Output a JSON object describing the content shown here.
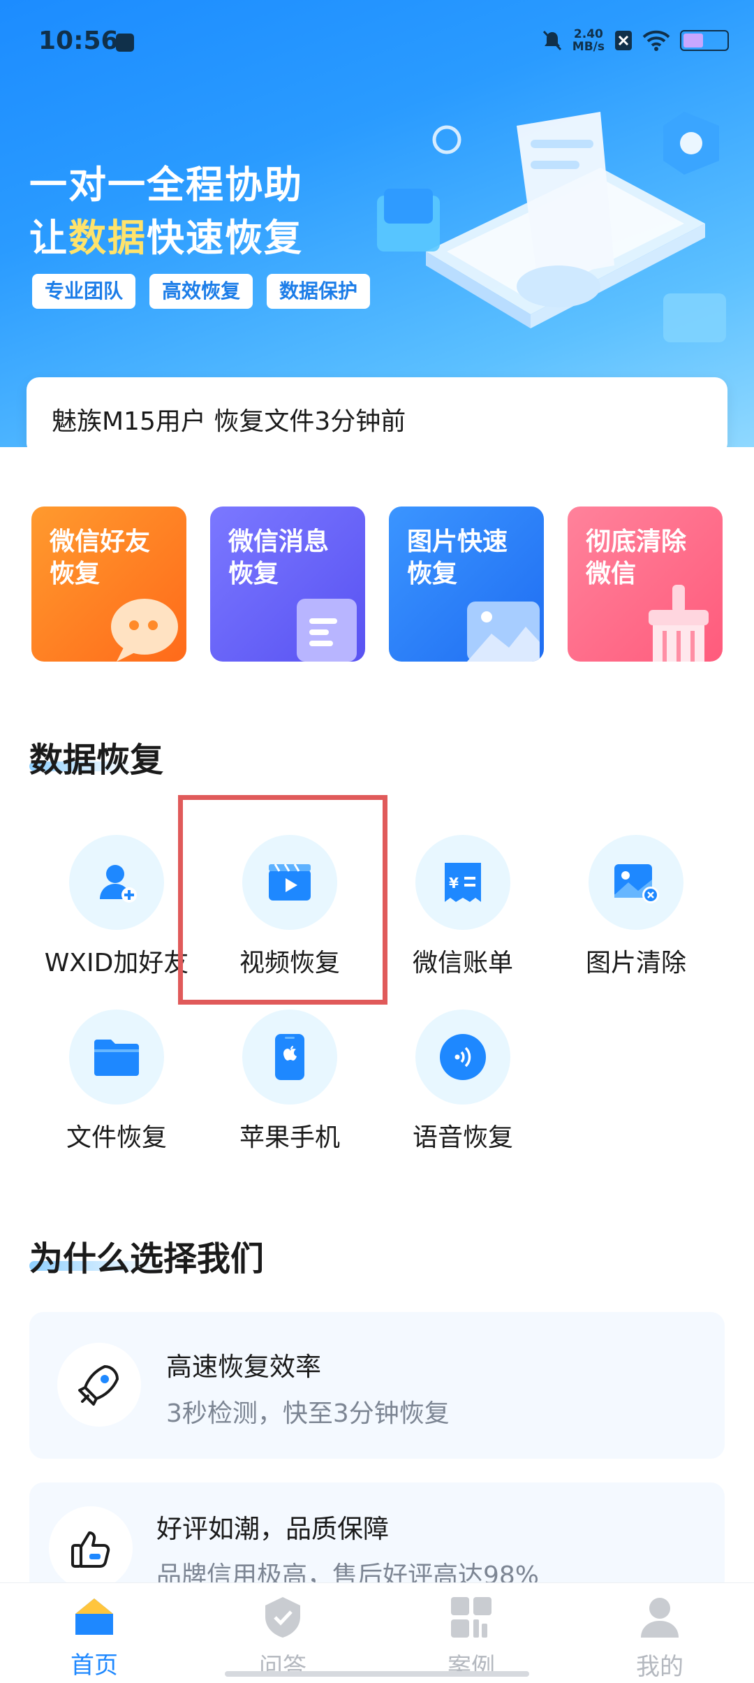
{
  "status_bar": {
    "time": "10:56",
    "speed_value": "2.40",
    "speed_unit": "MB/s"
  },
  "banner": {
    "line1": "一对一全程协助",
    "line2_prefix": "让",
    "line2_highlight": "数据",
    "line2_suffix": "快速恢复",
    "tags": [
      "专业团队",
      "高效恢复",
      "数据保护"
    ],
    "notice": "魅族M15用户  恢复文件3分钟前"
  },
  "feature_cards": [
    {
      "line1": "微信好友",
      "line2": "恢复",
      "color_top": "#ff8a1f",
      "color_bottom": "#ff6a1a"
    },
    {
      "line1": "微信消息",
      "line2": "恢复",
      "color_top": "#6f6bff",
      "color_bottom": "#5b55f5"
    },
    {
      "line1": "图片快速",
      "line2": "恢复",
      "color_top": "#2f8bff",
      "color_bottom": "#1e6ff5"
    },
    {
      "line1": "彻底清除",
      "line2": "微信",
      "color_top": "#ff7a95",
      "color_bottom": "#ff5b7c"
    }
  ],
  "data_recovery": {
    "title": "数据恢复",
    "items": [
      {
        "label": "WXID加好友",
        "icon": "add-user-icon"
      },
      {
        "label": "视频恢复",
        "icon": "video-icon"
      },
      {
        "label": "微信账单",
        "icon": "bill-icon"
      },
      {
        "label": "图片清除",
        "icon": "image-clear-icon"
      },
      {
        "label": "文件恢复",
        "icon": "folder-icon"
      },
      {
        "label": "苹果手机",
        "icon": "apple-phone-icon"
      },
      {
        "label": "语音恢复",
        "icon": "voice-icon"
      }
    ]
  },
  "why_us": {
    "title": "为什么选择我们",
    "cards": [
      {
        "title": "高速恢复效率",
        "desc": "3秒检测，快至3分钟恢复",
        "icon": "rocket-icon"
      },
      {
        "title": "好评如潮，品质保障",
        "desc": "品牌信用极高，售后好评高达98%",
        "icon": "thumbs-up-icon"
      }
    ]
  },
  "bottom_nav": [
    {
      "label": "首页",
      "active": true
    },
    {
      "label": "问答",
      "active": false
    },
    {
      "label": "案例",
      "active": false
    },
    {
      "label": "我的",
      "active": false
    }
  ],
  "colors": {
    "accent": "#1e88ff",
    "highlight_box": "#e05a5a",
    "inactive": "#b4b8bf"
  }
}
